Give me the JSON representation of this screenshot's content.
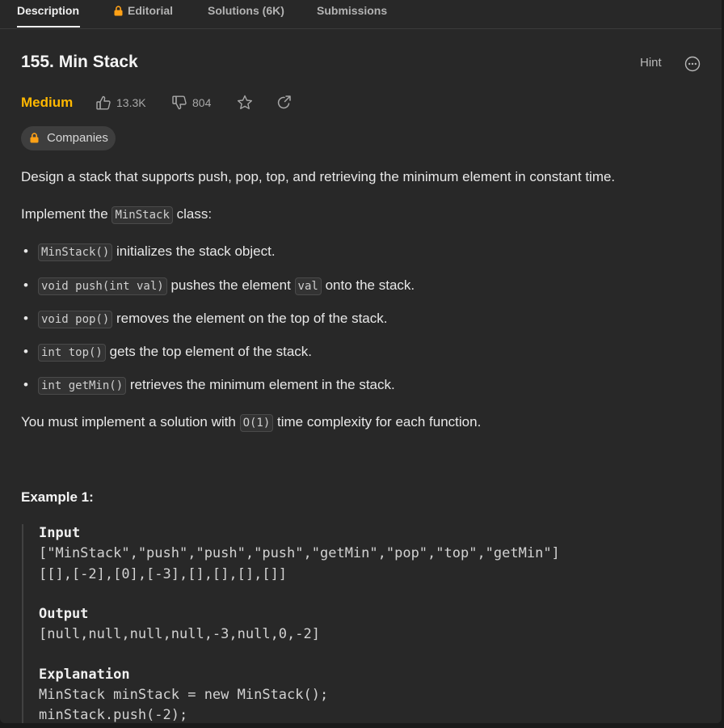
{
  "tabs": {
    "description": "Description",
    "editorial": "Editorial",
    "solutions": "Solutions (6K)",
    "submissions": "Submissions"
  },
  "problem": {
    "title": "155. Min Stack",
    "hint": "Hint",
    "difficulty": "Medium",
    "likes": "13.3K",
    "dislikes": "804",
    "companies": "Companies"
  },
  "description": {
    "p1": "Design a stack that supports push, pop, top, and retrieving the minimum element in constant time.",
    "p2_pre": "Implement the ",
    "p2_code": "MinStack",
    "p2_post": " class:",
    "items": [
      {
        "code": "MinStack()",
        "text": " initializes the stack object."
      },
      {
        "code": "void push(int val)",
        "text": " pushes the element ",
        "code2": "val",
        "text2": " onto the stack."
      },
      {
        "code": "void pop()",
        "text": " removes the element on the top of the stack."
      },
      {
        "code": "int top()",
        "text": " gets the top element of the stack."
      },
      {
        "code": "int getMin()",
        "text": " retrieves the minimum element in the stack."
      }
    ],
    "p3_pre": "You must implement a solution with ",
    "p3_code": "O(1)",
    "p3_post": " time complexity for each function."
  },
  "example": {
    "title": "Example 1:",
    "input_label": "Input",
    "input_line1": "[\"MinStack\",\"push\",\"push\",\"push\",\"getMin\",\"pop\",\"top\",\"getMin\"]",
    "input_line2": "[[],[-2],[0],[-3],[],[],[],[]]",
    "output_label": "Output",
    "output_line": "[null,null,null,null,-3,null,0,-2]",
    "explanation_label": "Explanation",
    "expl_line1": "MinStack minStack = new MinStack();",
    "expl_line2": "minStack.push(-2);"
  },
  "colors": {
    "difficulty_medium": "#ffb800",
    "background": "#282828"
  }
}
